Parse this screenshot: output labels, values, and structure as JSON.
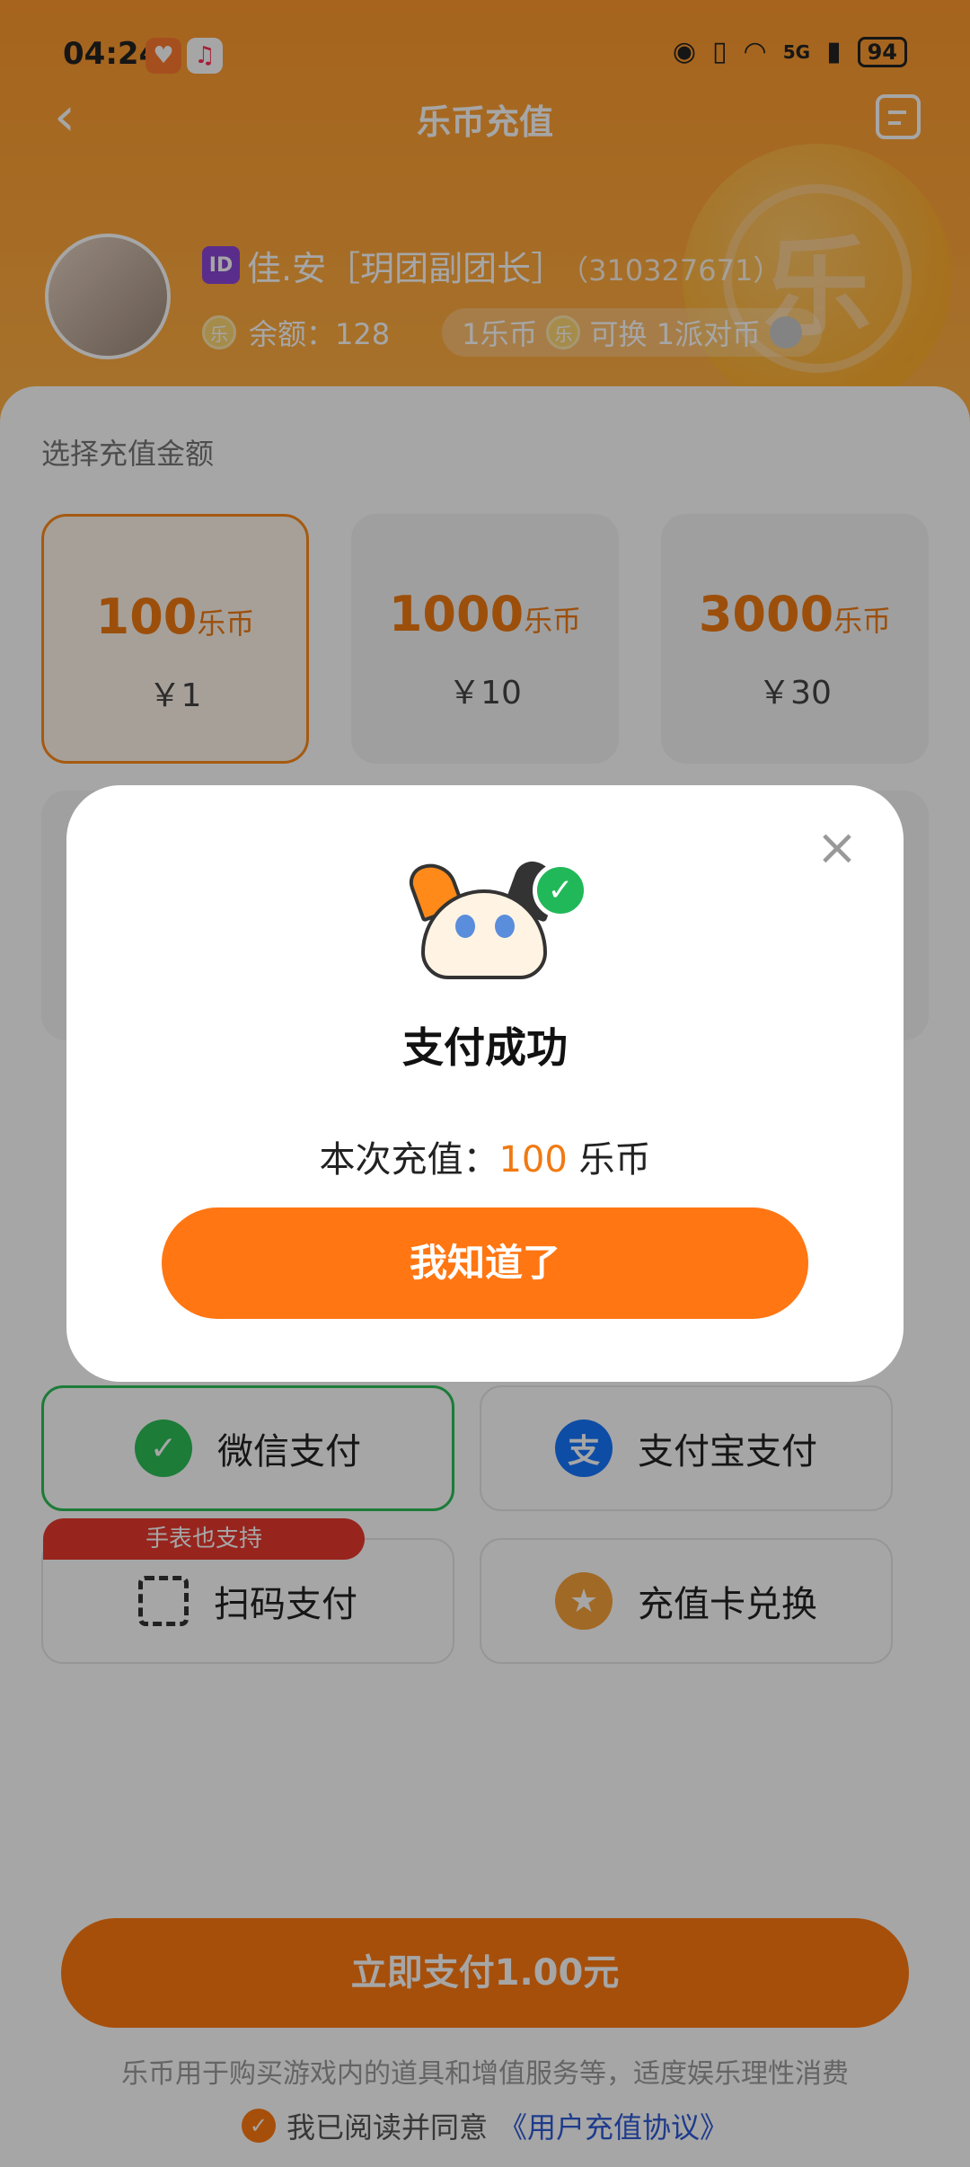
{
  "status_bar": {
    "time": "04:24",
    "battery": "94",
    "network": "5G"
  },
  "nav": {
    "title": "乐币充值"
  },
  "profile": {
    "id_badge": "ID",
    "name": "佳.安［玥团副团长］",
    "uid": "（310327671）",
    "balance_label": "余额：128",
    "rate_text": "1乐币",
    "rate_text2": "可换 1派对币",
    "coin_glyph": "乐"
  },
  "amounts": {
    "section_title": "选择充值金额",
    "unit": "乐币",
    "items": [
      {
        "coins": "100",
        "price": "￥1"
      },
      {
        "coins": "1000",
        "price": "￥10"
      },
      {
        "coins": "3000",
        "price": "￥30"
      }
    ]
  },
  "payment": {
    "wechat": "微信支付",
    "alipay": "支付宝支付",
    "scan": "扫码支付",
    "card": "充值卡兑换",
    "watch_tag": "手表也支持",
    "alipay_glyph": "支"
  },
  "footer": {
    "pay_button": "立即支付1.00元",
    "disclaimer": "乐币用于购买游戏内的道具和增值服务等，适度娱乐理性消费",
    "agree_prefix": "我已阅读并同意",
    "agree_link": "《用户充值协议》"
  },
  "modal": {
    "title": "支付成功",
    "desc_prefix": "本次充值：",
    "desc_amount": "100",
    "desc_unit": "乐币",
    "button": "我知道了",
    "close": "×"
  },
  "colors": {
    "accent": "#ff7a12",
    "success": "#21b85a"
  }
}
